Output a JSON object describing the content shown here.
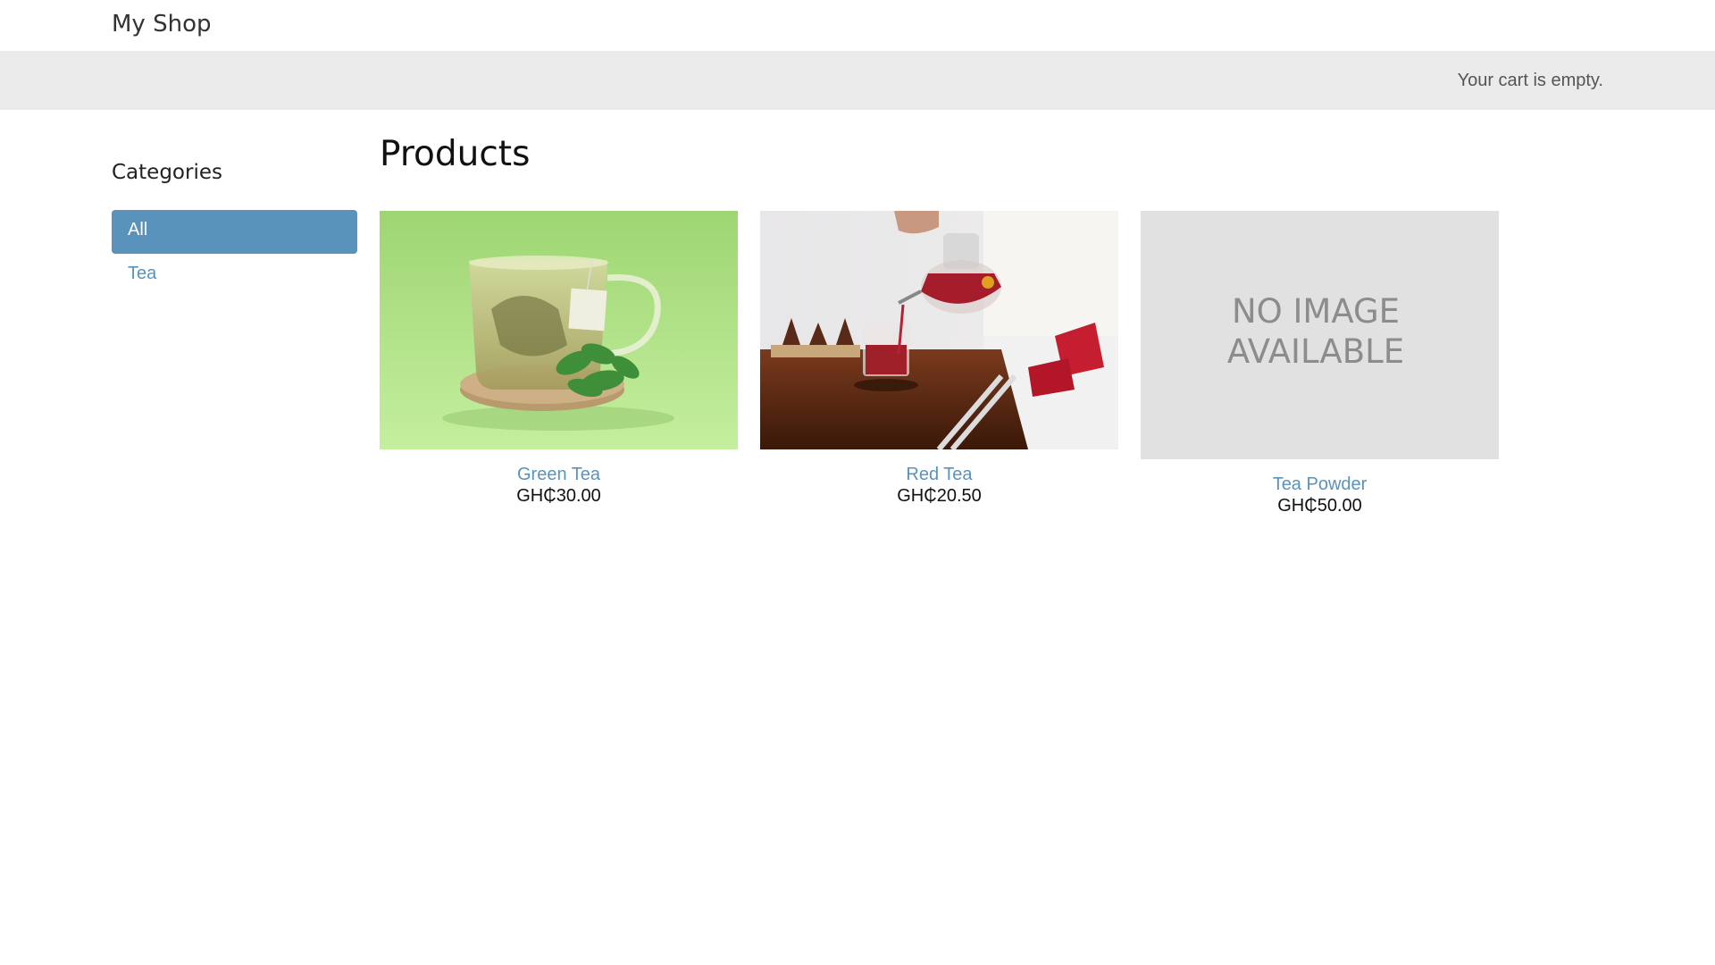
{
  "header": {
    "shop_name": "My Shop"
  },
  "cart": {
    "status_text": "Your cart is empty."
  },
  "sidebar": {
    "title": "Categories",
    "items": [
      {
        "label": "All",
        "active": true
      },
      {
        "label": "Tea",
        "active": false
      }
    ]
  },
  "main": {
    "title": "Products",
    "products": [
      {
        "name": "Green Tea",
        "price": "GH₵30.00",
        "image": "green-tea-cup-photo"
      },
      {
        "name": "Red Tea",
        "price": "GH₵20.50",
        "image": "red-tea-pouring-photo"
      },
      {
        "name": "Tea Powder",
        "price": "GH₵50.00",
        "image": "no-image-placeholder",
        "placeholder_text": [
          "NO IMAGE",
          "AVAILABLE"
        ]
      }
    ]
  },
  "colors": {
    "accent": "#5993bb",
    "cart_bar": "#ebebeb",
    "placeholder_bg": "#e1e1e1"
  }
}
